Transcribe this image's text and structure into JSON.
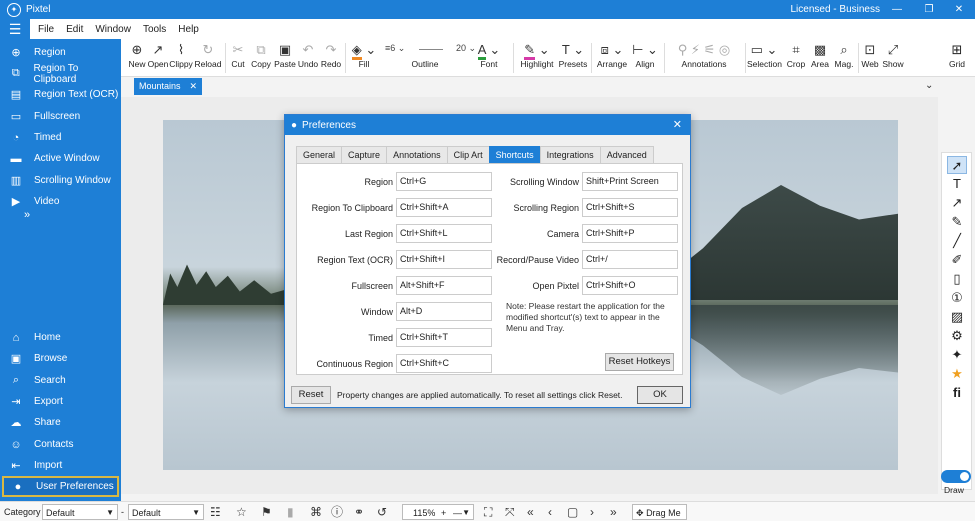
{
  "titlebar": {
    "app_name": "Pixtel",
    "license": "Licensed - Business",
    "minimize": "—",
    "maximize": "❐",
    "close": "✕"
  },
  "menubar": {
    "items": [
      "File",
      "Edit",
      "Window",
      "Tools",
      "Help"
    ]
  },
  "sidebar": {
    "capture_items": [
      {
        "label": "Region",
        "icon": "crosshair-icon"
      },
      {
        "label": "Region To Clipboard",
        "icon": "clipboard-icon"
      },
      {
        "label": "Region Text (OCR)",
        "icon": "ocr-icon"
      },
      {
        "label": "Fullscreen",
        "icon": "fullscreen-icon"
      },
      {
        "label": "Timed",
        "icon": "timer-icon"
      },
      {
        "label": "Active Window",
        "icon": "window-icon"
      },
      {
        "label": "Scrolling Window",
        "icon": "scroll-icon"
      },
      {
        "label": "Video",
        "icon": "video-icon"
      }
    ],
    "more": "»",
    "nav_items": [
      {
        "label": "Home",
        "icon": "home-icon"
      },
      {
        "label": "Browse",
        "icon": "folder-icon"
      },
      {
        "label": "Search",
        "icon": "search-icon"
      },
      {
        "label": "Export",
        "icon": "export-icon"
      },
      {
        "label": "Share",
        "icon": "share-icon"
      },
      {
        "label": "Contacts",
        "icon": "contacts-icon"
      },
      {
        "label": "Import",
        "icon": "import-icon"
      },
      {
        "label": "User Preferences",
        "icon": "user-icon"
      }
    ]
  },
  "toolbar": {
    "new": "New",
    "open": "Open",
    "clippy": "Clippy",
    "reload": "Reload",
    "cut": "Cut",
    "copy": "Copy",
    "paste": "Paste",
    "undo": "Undo",
    "redo": "Redo",
    "fill": "Fill",
    "outline_size": "6",
    "outline": "Outline",
    "font_size": "20",
    "font": "Font",
    "highlight": "Highlight",
    "presets": "Presets",
    "arrange": "Arrange",
    "align": "Align",
    "annotations": "Annotations",
    "selection": "Selection",
    "crop": "Crop",
    "area": "Area",
    "mag": "Mag.",
    "web": "Web",
    "show": "Show",
    "grid": "Grid",
    "fill_color": "#f08a24",
    "font_color": "#2a9d3c",
    "highlight_color": "#d63aa8"
  },
  "tabs": {
    "active_tab": "Mountains",
    "close": "✕"
  },
  "dialog": {
    "title": "Preferences",
    "close": "✕",
    "tabs": [
      "General",
      "Capture",
      "Annotations",
      "Clip Art",
      "Shortcuts",
      "Integrations",
      "Advanced"
    ],
    "active_tab": "Shortcuts",
    "left_shortcuts": [
      {
        "label": "Region",
        "value": "Ctrl+G"
      },
      {
        "label": "Region To Clipboard",
        "value": "Ctrl+Shift+A"
      },
      {
        "label": "Last Region",
        "value": "Ctrl+Shift+L"
      },
      {
        "label": "Region Text (OCR)",
        "value": "Ctrl+Shift+I"
      },
      {
        "label": "Fullscreen",
        "value": "Alt+Shift+F"
      },
      {
        "label": "Window",
        "value": "Alt+D"
      },
      {
        "label": "Timed",
        "value": "Ctrl+Shift+T"
      },
      {
        "label": "Continuous Region",
        "value": "Ctrl+Shift+C"
      }
    ],
    "right_shortcuts": [
      {
        "label": "Scrolling Window",
        "value": "Shift+Print Screen"
      },
      {
        "label": "Scrolling Region",
        "value": "Ctrl+Shift+S"
      },
      {
        "label": "Camera",
        "value": "Ctrl+Shift+P"
      },
      {
        "label": "Record/Pause Video",
        "value": "Ctrl+/"
      },
      {
        "label": "Open Pixtel",
        "value": "Ctrl+Shift+O"
      }
    ],
    "note": "Note: Please restart the application for the modified shortcut'(s) text to appear in the Menu and Tray.",
    "reset_hotkeys": "Reset Hotkeys",
    "reset": "Reset",
    "footer_text": "Property changes are applied automatically. To reset all settings click Reset.",
    "ok": "OK"
  },
  "right_tools": {
    "draw_label": "Draw",
    "fi_label": "fi"
  },
  "statusbar": {
    "category_label": "Category",
    "category_value": "Default",
    "secondary_value": "Default",
    "zoom": "115%",
    "drag_me": "Drag Me"
  }
}
